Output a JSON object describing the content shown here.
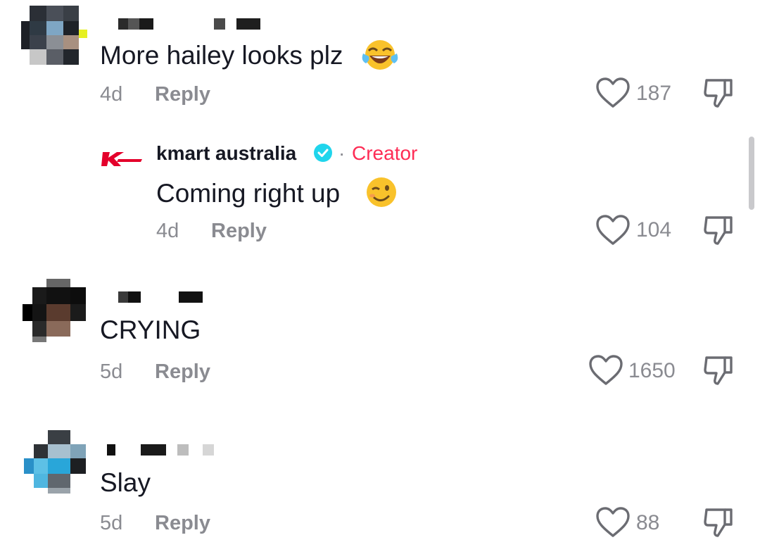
{
  "comments": [
    {
      "text": "More hailey looks plz",
      "time": "4d",
      "reply_label": "Reply",
      "likes": "187",
      "emoji": "face-with-tears-of-joy"
    },
    {
      "author": "kmart australia",
      "creator_label": "Creator",
      "separator": "·",
      "text": "Coming right up",
      "time": "4d",
      "reply_label": "Reply",
      "likes": "104",
      "emoji": "winking-face"
    },
    {
      "text": "CRYING",
      "time": "5d",
      "reply_label": "Reply",
      "likes": "1650"
    },
    {
      "text": "Slay",
      "time": "5d",
      "reply_label": "Reply",
      "likes": "88"
    }
  ],
  "colors": {
    "accent": "#fe2c55",
    "secondary_text": "#8a8b91",
    "primary_text": "#161823",
    "verified": "#20d5ec",
    "kmart_red": "#e4002b"
  }
}
